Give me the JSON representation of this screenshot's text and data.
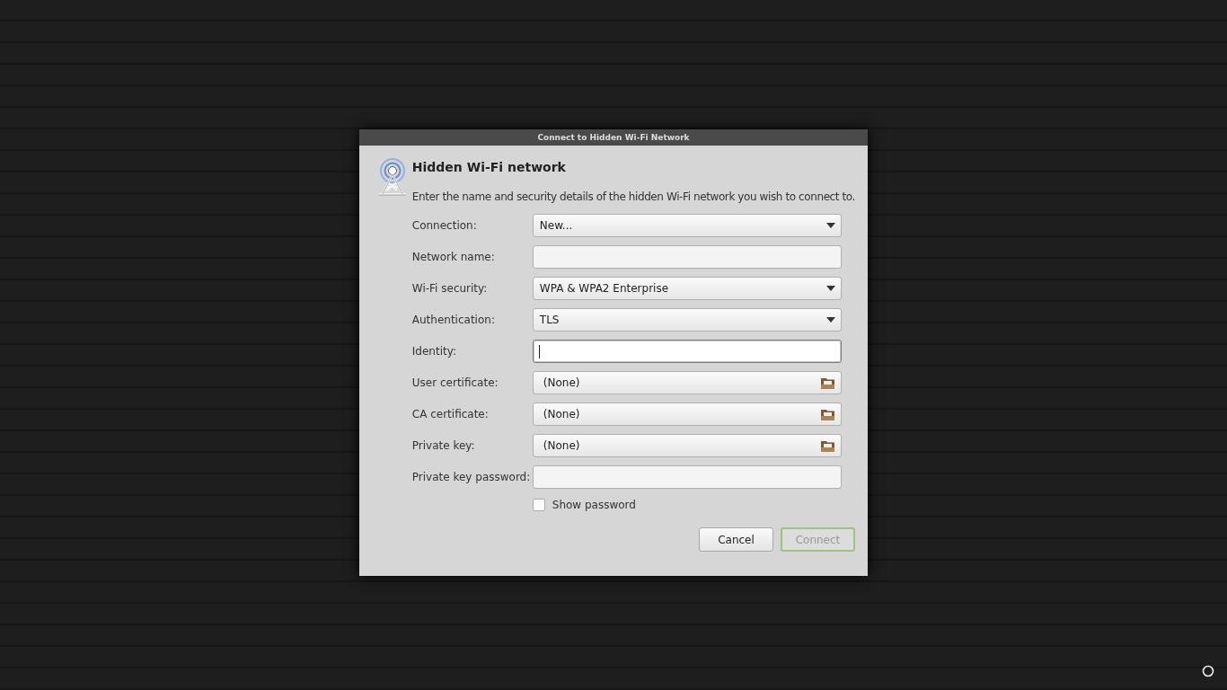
{
  "window": {
    "title": "Connect to Hidden Wi-Fi Network"
  },
  "heading": "Hidden Wi-Fi network",
  "description": "Enter the name and security details of the hidden Wi-Fi network you wish to connect to.",
  "fields": [
    {
      "kind": "dropdown",
      "label": "Connection:",
      "value": "New...",
      "focused": false
    },
    {
      "kind": "entry",
      "label": "Network name:",
      "focused": false
    },
    {
      "kind": "dropdown",
      "label": "Wi-Fi security:",
      "value": "WPA & WPA2 Enterprise",
      "focused": false
    },
    {
      "kind": "dropdown",
      "label": "Authentication:",
      "value": "TLS",
      "focused": false
    },
    {
      "kind": "entry",
      "label": "Identity:",
      "focused": true
    },
    {
      "kind": "file",
      "label": "User certificate:",
      "value": "(None)",
      "focused": false
    },
    {
      "kind": "file",
      "label": "CA certificate:",
      "value": "(None)",
      "focused": false
    },
    {
      "kind": "file",
      "label": "Private key:",
      "value": "(None)",
      "focused": false
    },
    {
      "kind": "entry",
      "label": "Private key password:",
      "focused": false
    }
  ],
  "show_password": {
    "label": "Show password",
    "checked": false
  },
  "buttons": [
    {
      "label": "Cancel",
      "disabled": false
    },
    {
      "label": "Connect",
      "disabled": true
    }
  ]
}
